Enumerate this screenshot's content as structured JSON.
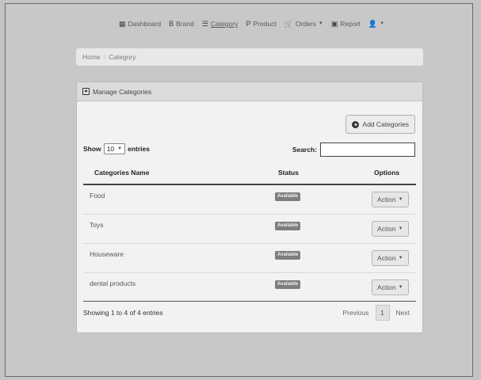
{
  "nav": {
    "items": [
      {
        "label": "Dashboard",
        "icon": "dashboard-icon",
        "glyph": "▦"
      },
      {
        "label": "Brand",
        "icon": "brand-icon",
        "glyph": "B"
      },
      {
        "label": "Category",
        "icon": "category-icon",
        "glyph": "☰"
      },
      {
        "label": "Product",
        "icon": "product-icon",
        "glyph": "P"
      },
      {
        "label": "Orders",
        "icon": "orders-icon",
        "glyph": "🛒"
      },
      {
        "label": "Report",
        "icon": "report-icon",
        "glyph": "▣"
      }
    ],
    "user_glyph": "👤"
  },
  "breadcrumb": {
    "home": "Home",
    "current": "Category",
    "separator": "/"
  },
  "panel": {
    "title": "Manage Categories"
  },
  "add_button": {
    "label": "Add Categories"
  },
  "table_controls": {
    "show_label": "Show",
    "page_size": "10",
    "entries_label": "entries",
    "search_label": "Search:",
    "search_value": ""
  },
  "table": {
    "headers": {
      "name": "Categories Name",
      "status": "Status",
      "options": "Options"
    },
    "rows": [
      {
        "name": "Food",
        "status": "Available",
        "action": "Action"
      },
      {
        "name": "Toys",
        "status": "Available",
        "action": "Action"
      },
      {
        "name": "Houseware",
        "status": "Available",
        "action": "Action"
      },
      {
        "name": "dental products",
        "status": "Available",
        "action": "Action"
      }
    ]
  },
  "footer": {
    "info": "Showing 1 to 4 of 4 entries",
    "previous": "Previous",
    "page": "1",
    "next": "Next"
  }
}
